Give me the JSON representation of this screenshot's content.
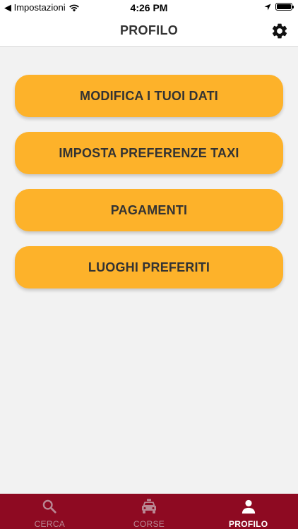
{
  "status_bar": {
    "back_label": "◀ Impostazioni",
    "time": "4:26 PM"
  },
  "header": {
    "title": "PROFILO",
    "settings_icon": "gear-icon"
  },
  "menu": {
    "items": [
      {
        "label": "MODIFICA I TUOI DATI"
      },
      {
        "label": "IMPOSTA PREFERENZE TAXI"
      },
      {
        "label": "PAGAMENTI"
      },
      {
        "label": "LUOGHI PREFERITI"
      }
    ],
    "button_color": "#fdb22a"
  },
  "tabbar": {
    "background": "#8e0a22",
    "tabs": [
      {
        "label": "CERCA",
        "icon": "search-icon",
        "active": false
      },
      {
        "label": "CORSE",
        "icon": "taxi-icon",
        "active": false
      },
      {
        "label": "PROFILO",
        "icon": "user-icon",
        "active": true
      }
    ]
  }
}
